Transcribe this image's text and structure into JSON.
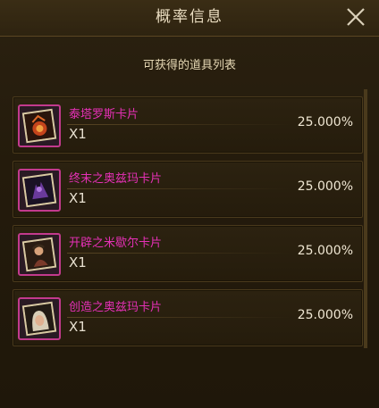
{
  "header": {
    "title": "概率信息"
  },
  "subtitle": "可获得的道具列表",
  "items": [
    {
      "name": "泰塔罗斯卡片",
      "qty": "X1",
      "pct": "25.000%",
      "icon": "fire-card-icon"
    },
    {
      "name": "终末之奥兹玛卡片",
      "qty": "X1",
      "pct": "25.000%",
      "icon": "dark-card-icon"
    },
    {
      "name": "开辟之米歇尔卡片",
      "qty": "X1",
      "pct": "25.000%",
      "icon": "warrior-card-icon"
    },
    {
      "name": "创造之奥兹玛卡片",
      "qty": "X1",
      "pct": "25.000%",
      "icon": "hooded-card-icon"
    }
  ],
  "colors": {
    "name": "#e530b6",
    "frame": "#c23a8d",
    "text": "#e7e0d0"
  }
}
